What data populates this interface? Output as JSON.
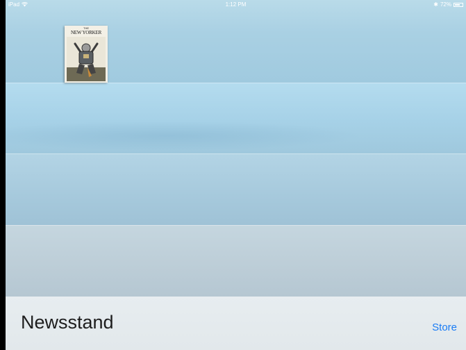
{
  "status_bar": {
    "device": "iPad",
    "wifi_icon": "wifi-icon",
    "time": "1:12 PM",
    "bluetooth_icon": "bluetooth-icon",
    "battery_percent": "72%",
    "battery_level": 0.72
  },
  "shelf": {
    "magazines": [
      {
        "small_text": "THE",
        "title": "NEW YORKER",
        "cover_icon": "magazine-cover"
      }
    ]
  },
  "footer": {
    "title": "Newsstand",
    "store_label": "Store"
  },
  "colors": {
    "accent": "#1a7cf5",
    "shelf_blue": "#a9d0e3"
  }
}
